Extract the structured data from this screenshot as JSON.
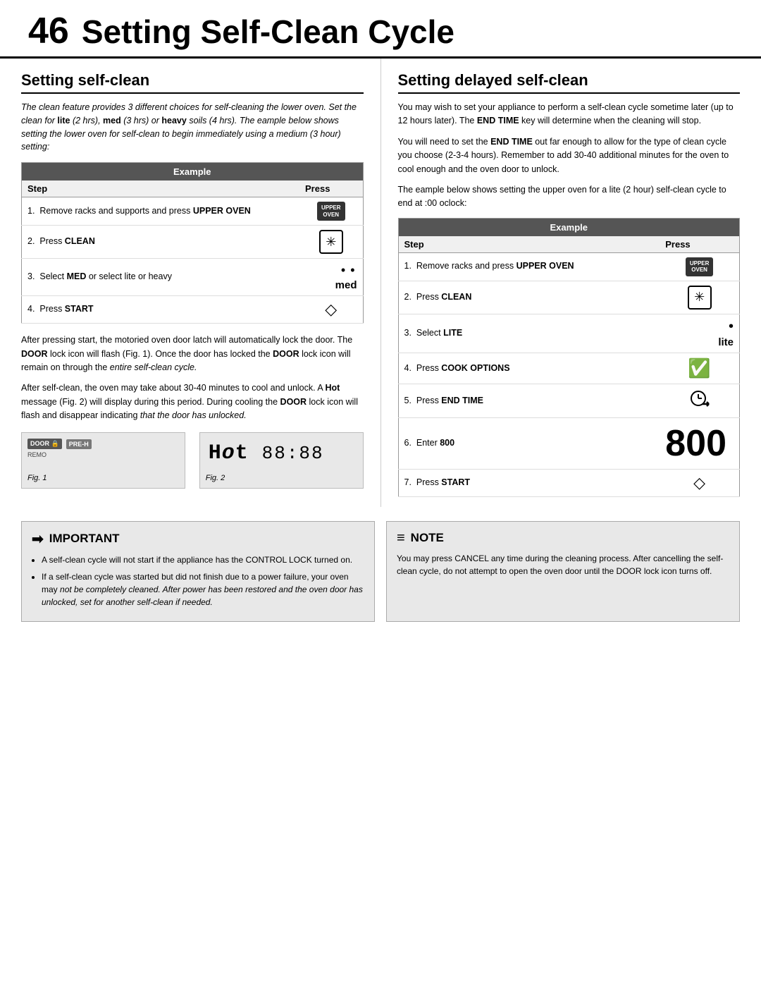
{
  "header": {
    "page_number": "46",
    "title": "Setting Self-Clean Cycle"
  },
  "left_section": {
    "title": "Setting self-clean",
    "intro": "The clean feature provides 3 different choices for self-cleaning the lower oven. Set the clean for lite (2 hrs), med (3 hrs) or heavy soils (4 hrs). The eample below shows setting the lower oven for self-clean to begin immediately using a medium (3 hour) setting:",
    "example_label": "Example",
    "col_step": "Step",
    "col_press": "Press",
    "steps": [
      {
        "num": "1.",
        "text": "Remove racks and supports and press UPPER OVEN",
        "press_type": "upper_oven"
      },
      {
        "num": "2.",
        "text": "Press CLEAN",
        "press_type": "clean"
      },
      {
        "num": "3.",
        "text": "Select MED or select lite or heavy",
        "press_type": "dots_med"
      },
      {
        "num": "4.",
        "text": "Press START",
        "press_type": "start"
      }
    ],
    "body_texts": [
      "After pressing start, the motoried oven door latch will automatically lock the door. The DOOR lock icon will flash (Fig. 1). Once the door has locked the DOOR lock icon will remain on through the entire self-clean cycle.",
      "After self-clean, the oven may take about 30-40 minutes to cool and unlock. A Hot message (Fig. 2) will display during this period. During cooling the DOOR lock icon will flash and disappear indicating that the door has unlocked."
    ],
    "fig1_label": "Fig. 1",
    "fig2_label": "Fig. 2",
    "fig2_text": "Hot 88:88"
  },
  "right_section": {
    "title": "Setting delayed self-clean",
    "intro1": "You may wish to set your appliance to perform a self-clean cycle sometime later (up to 12 hours later). The END TIME key will determine when the cleaning will stop.",
    "intro2": "You will need to set the END TIME out far enough to allow for the type of clean cycle you choose (2-3-4 hours). Remember to add 30-40 additional minutes for the oven to cool enough and the oven door to unlock.",
    "intro3": "The eample below shows setting the upper oven for a lite (2 hour) self-clean cycle to end at :00 oclock:",
    "example_label": "Example",
    "col_step": "Step",
    "col_press": "Press",
    "steps": [
      {
        "num": "1.",
        "text": "Remove racks and press UPPER OVEN",
        "press_type": "upper_oven"
      },
      {
        "num": "2.",
        "text": "Press CLEAN",
        "press_type": "clean"
      },
      {
        "num": "3.",
        "text": "Select LITE",
        "press_type": "lite"
      },
      {
        "num": "4.",
        "text": "Press COOK OPTIONS",
        "press_type": "cook_options"
      },
      {
        "num": "5.",
        "text": "Press END TIME",
        "press_type": "end_time"
      },
      {
        "num": "6.",
        "text": "Enter 800",
        "press_type": "big_800"
      },
      {
        "num": "7.",
        "text": "Press START",
        "press_type": "start"
      }
    ]
  },
  "important_box": {
    "title": "IMPORTANT",
    "icon": "➡",
    "items": [
      "A self-clean cycle will not start if the appliance has the CONTROL LOCK turned on.",
      "If a self-clean cycle was started but did not finish due to a power failure, your oven may not be completely cleaned. After power has been restored and the oven door has unlocked, set for another self-clean if needed."
    ]
  },
  "note_box": {
    "title": "NOTE",
    "icon": "≡",
    "text": "You may press CANCEL any time during the cleaning process. After cancelling the self-clean cycle, do not attempt to open the oven door until the DOOR lock icon turns off."
  }
}
